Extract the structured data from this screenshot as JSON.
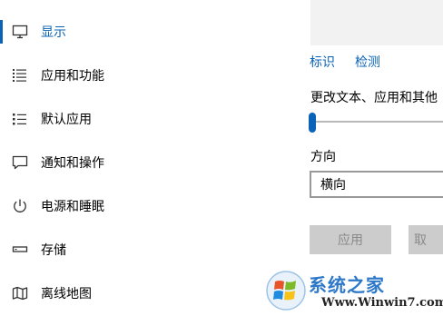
{
  "nav": {
    "items": [
      {
        "label": "显示",
        "icon": "monitor-icon",
        "active": true
      },
      {
        "label": "应用和功能",
        "icon": "apps-list-icon",
        "active": false
      },
      {
        "label": "默认应用",
        "icon": "default-apps-icon",
        "active": false
      },
      {
        "label": "通知和操作",
        "icon": "notification-icon",
        "active": false
      },
      {
        "label": "电源和睡眠",
        "icon": "power-icon",
        "active": false
      },
      {
        "label": "存储",
        "icon": "storage-icon",
        "active": false
      },
      {
        "label": "离线地图",
        "icon": "map-icon",
        "active": false
      }
    ]
  },
  "display": {
    "identify_link": "标识",
    "detect_link": "检测",
    "scale_label": "更改文本、应用和其他",
    "scale_slider_value": 0,
    "orientation_label": "方向",
    "orientation_value": "横向",
    "apply_button": "应用",
    "cancel_button": "取"
  },
  "watermark": {
    "site_name": "系统之家",
    "url": "Www.Winwin7.com"
  },
  "colors": {
    "accent": "#0a63b8",
    "button_bg": "#cccccc",
    "button_text": "#8a8a8a",
    "preview_bg": "#f2f2f2"
  }
}
